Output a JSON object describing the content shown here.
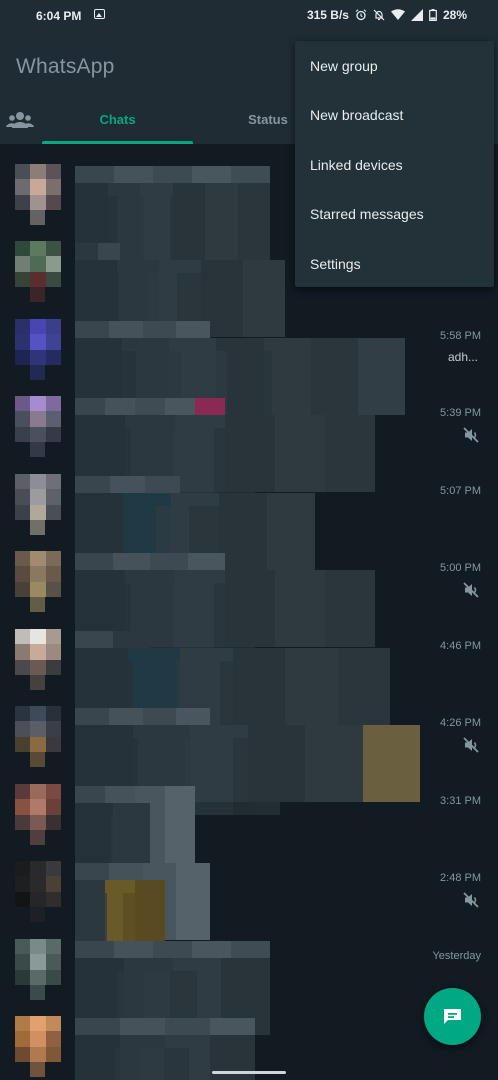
{
  "status_bar": {
    "time": "6:04 PM",
    "net_speed": "315 B/s",
    "battery": "28%"
  },
  "app": {
    "title": "WhatsApp"
  },
  "tabs": [
    {
      "label": "Chats",
      "active": true
    },
    {
      "label": "Status",
      "active": false
    }
  ],
  "menu": {
    "items": [
      {
        "label": "New group"
      },
      {
        "label": "New broadcast"
      },
      {
        "label": "Linked devices"
      },
      {
        "label": "Starred messages"
      },
      {
        "label": "Settings"
      }
    ]
  },
  "chats": [
    {
      "time": "",
      "snippet": "",
      "muted": false
    },
    {
      "time": "",
      "snippet": "",
      "muted": false
    },
    {
      "time": "5:58 PM",
      "snippet": "adh...",
      "muted": false
    },
    {
      "time": "5:39 PM",
      "snippet": "",
      "muted": true
    },
    {
      "time": "5:07 PM",
      "snippet": "",
      "muted": false
    },
    {
      "time": "5:00 PM",
      "snippet": "",
      "muted": true
    },
    {
      "time": "4:46 PM",
      "snippet": "",
      "muted": false
    },
    {
      "time": "4:26 PM",
      "snippet": "",
      "muted": true
    },
    {
      "time": "3:31 PM",
      "snippet": "",
      "muted": false
    },
    {
      "time": "2:48 PM",
      "snippet": "",
      "muted": true
    },
    {
      "time": "Yesterday",
      "snippet": "",
      "muted": false
    },
    {
      "time": "",
      "snippet": "",
      "muted": false
    }
  ],
  "colors": {
    "accent": "#00a884",
    "background": "#111b21",
    "header": "#1f2c34",
    "menu": "#233138",
    "secondary_text": "#8696a0"
  },
  "icons": {
    "community": "community-icon",
    "mute": "mute-icon",
    "new_chat": "new-chat-icon"
  }
}
